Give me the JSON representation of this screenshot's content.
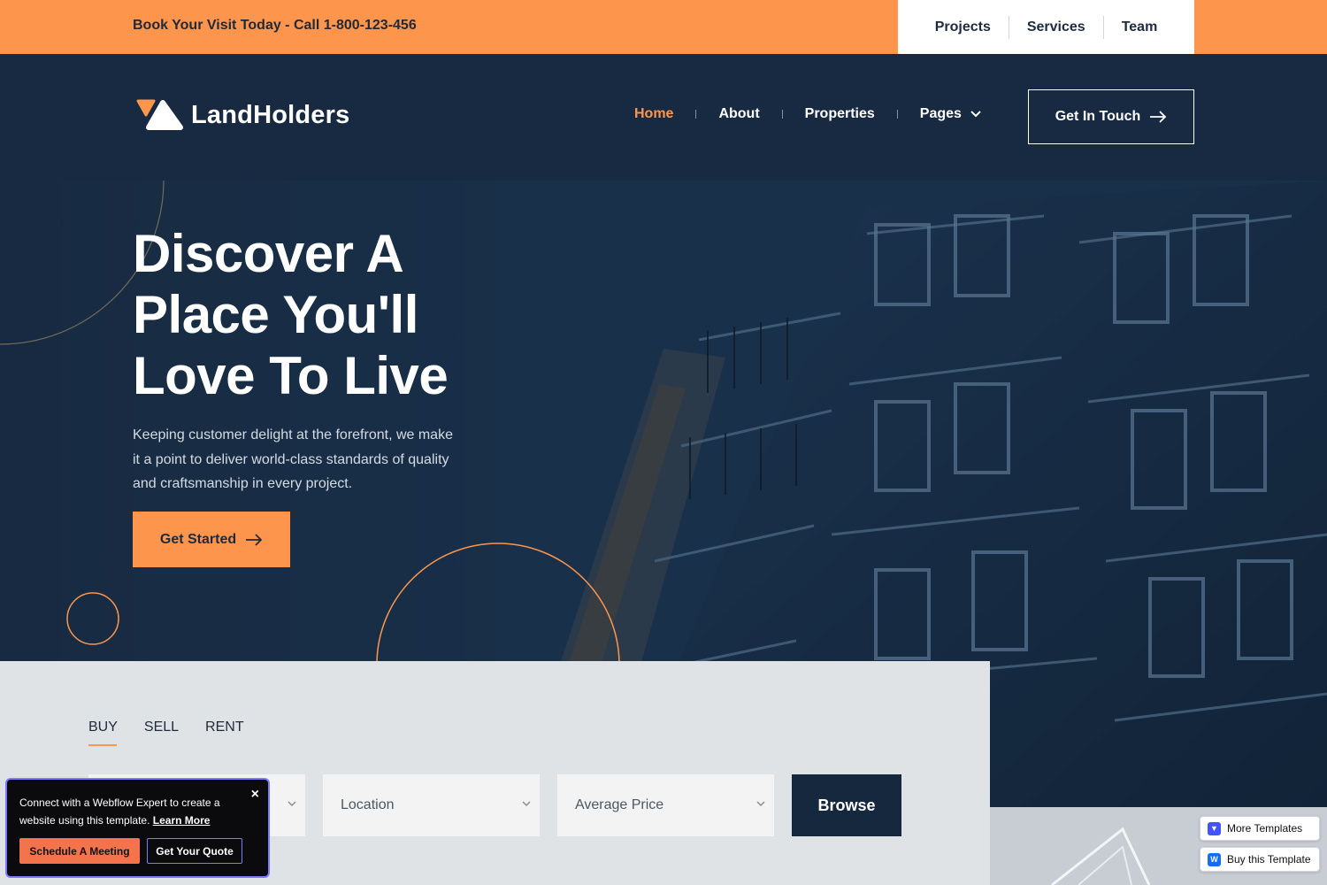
{
  "topbar": {
    "promo": "Book Your Visit Today - Call 1-800-123-456",
    "links": [
      "Projects",
      "Services",
      "Team"
    ]
  },
  "brand": {
    "name": "LandHolders",
    "accent": "#fd964c",
    "navy": "#16283e"
  },
  "nav": {
    "items": [
      "Home",
      "About",
      "Properties",
      "Pages"
    ],
    "active": "Home",
    "cta": "Get In Touch"
  },
  "hero": {
    "title": "Discover A Place You'll Love To Live",
    "title_lines": [
      "Discover A",
      "Place You'll",
      "Love To Live"
    ],
    "description": "Keeping customer delight at the forefront, we make it a point to deliver world-class standards of quality and craftsmanship in every project.",
    "button": "Get Started"
  },
  "search": {
    "tabs": [
      "BUY",
      "SELL",
      "RENT"
    ],
    "active_tab": "BUY",
    "fields": [
      "Location",
      "Average Price"
    ],
    "button": "Browse"
  },
  "popup": {
    "message": "Connect with a Webflow Expert to create a website using this template.",
    "link": "Learn More",
    "primary": "Schedule A Meeting",
    "secondary": "Get Your Quote",
    "close": "×"
  },
  "webflow": {
    "more_templates": "More Templates",
    "buy_template": "Buy this Template"
  }
}
